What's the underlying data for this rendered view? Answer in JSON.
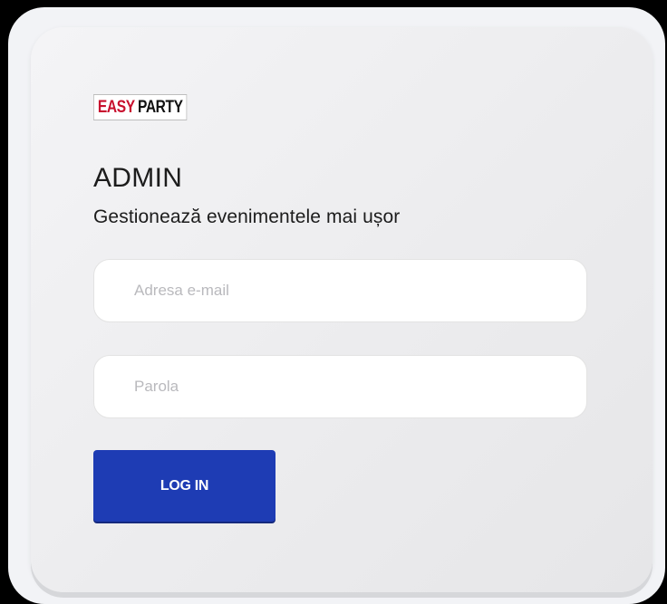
{
  "brand": {
    "logo_word1": "EASY",
    "logo_word2": "PARTY",
    "logo_color_primary": "#c8102e",
    "logo_color_secondary": "#111111"
  },
  "header": {
    "title": "ADMIN",
    "subtitle": "Gestionează evenimentele mai ușor"
  },
  "form": {
    "email_placeholder": "Adresa e-mail",
    "email_value": "",
    "password_placeholder": "Parola",
    "password_value": "",
    "submit_label": "LOG IN"
  },
  "colors": {
    "button_bg": "#1e3cb4",
    "background": "#f2f3f6"
  }
}
